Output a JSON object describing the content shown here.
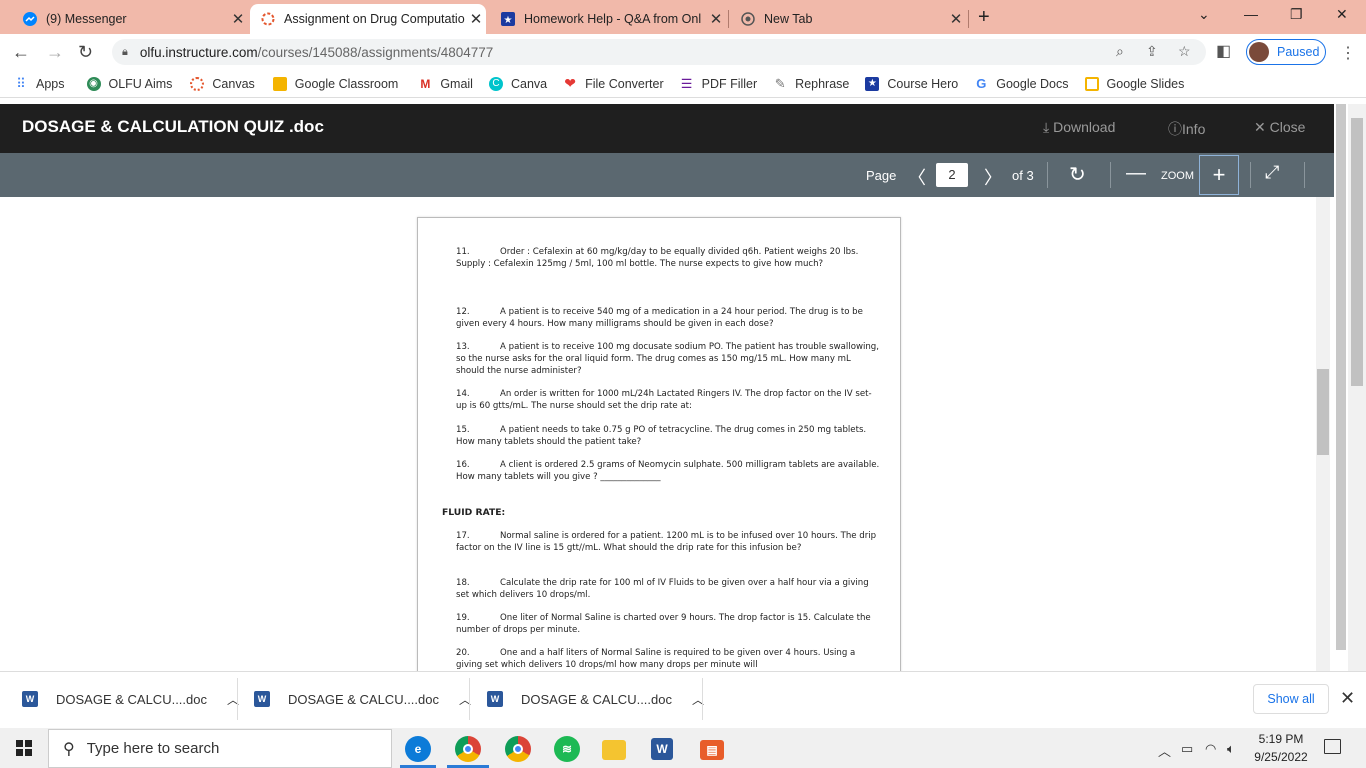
{
  "tabs": [
    {
      "title": "(9) Messenger",
      "icon": "messenger-icon",
      "color": "#0084ff"
    },
    {
      "title": "Assignment on Drug Computatio",
      "icon": "canvas-icon",
      "color": "#e4572e"
    },
    {
      "title": "Homework Help - Q&A from Onl",
      "icon": "course-hero-icon",
      "color": "#1b3aa0"
    },
    {
      "title": "New Tab",
      "icon": "chrome-icon",
      "color": "#555555"
    }
  ],
  "address": {
    "host": "olfu.instructure.com",
    "path": "/courses/145088/assignments/4804777",
    "profile_status": "Paused"
  },
  "bookmarks": [
    {
      "label": "Apps",
      "icon": "apps-grid-icon",
      "color": "#4285f4"
    },
    {
      "label": "OLFU Aims",
      "icon": "olfu-icon",
      "color": "#2e8b57"
    },
    {
      "label": "Canvas",
      "icon": "canvas-icon",
      "color": "#e4572e"
    },
    {
      "label": "Google Classroom",
      "icon": "classroom-icon",
      "color": "#f4b400"
    },
    {
      "label": "Gmail",
      "icon": "gmail-icon",
      "color": "#d93025"
    },
    {
      "label": "Canva",
      "icon": "canva-icon",
      "color": "#00c4cc"
    },
    {
      "label": "File Converter",
      "icon": "heart-icon",
      "color": "#e53935"
    },
    {
      "label": "PDF Filler",
      "icon": "pdf-filler-icon",
      "color": "#6a1b9a"
    },
    {
      "label": "Rephrase",
      "icon": "quill-icon",
      "color": "#777777"
    },
    {
      "label": "Course Hero",
      "icon": "course-hero-icon",
      "color": "#1b3aa0"
    },
    {
      "label": "Google Docs",
      "icon": "google-icon",
      "color": "#4285f4"
    },
    {
      "label": "Google Slides",
      "icon": "slides-icon",
      "color": "#f4b400"
    }
  ],
  "viewer": {
    "doc_title": "DOSAGE & CALCULATION QUIZ .doc",
    "download": "Download",
    "info": "Info",
    "close": "Close",
    "page_label": "Page",
    "page_current": "2",
    "page_total": "of 3",
    "zoom_label": "ZOOM"
  },
  "document": {
    "questions": [
      {
        "num": "11.",
        "text": "Order : Cefalexin at 60 mg/kg/day to be equally divided q6h. Patient weighs 20 lbs. Supply : Cefalexin 125mg / 5ml, 100 ml bottle. The nurse expects to give how much?"
      },
      {
        "num": "12.",
        "text": "A patient is to receive 540 mg of a medication in a 24 hour period.  The drug is to be given every 4 hours.  How many milligrams should be given in each dose?"
      },
      {
        "num": "13.",
        "text": "A patient is to receive  100 mg docusate sodium PO.  The patient has trouble swallowing, so the nurse asks for the oral liquid form.  The drug comes as 150 mg/15 mL.  How many mL should the nurse administer?"
      },
      {
        "num": "14.",
        "text": "An order is written for 1000 mL/24h  Lactated Ringers IV.  The drop factor on the IV set-up is 60 gtts/mL.  The nurse should set the drip rate at:"
      },
      {
        "num": "15.",
        "text": "A patient needs to take 0.75 g PO of tetracycline.  The drug comes in 250 mg tablets.  How many tablets should the patient take?"
      },
      {
        "num": "16.",
        "text": "A client is ordered 2.5 grams of Neomycin sulphate. 500 milligram tablets are available. How many tablets will you give ? ______________"
      }
    ],
    "section_heading": "FLUID RATE:",
    "fluid_questions": [
      {
        "num": "17.",
        "text": "Normal saline is ordered for a patient.  1200 mL is to be infused over 10 hours.  The drip factor on the IV line is 15 gtt//mL.  What should the drip rate for this infusion be?"
      },
      {
        "num": "18.",
        "text": "Calculate the drip rate for 100 ml of IV Fluids to be given over a half hour via a giving set which delivers 10 drops/ml."
      },
      {
        "num": "19.",
        "text": "One liter of Normal Saline is charted over 9 hours. The drop factor is 15. Calculate the number of drops per minute."
      },
      {
        "num": "20.",
        "text": "One and a half liters of Normal Saline is required to be given over 4 hours. Using a giving set which delivers 10 drops/ml how many drops per minute will"
      }
    ]
  },
  "downloads": {
    "items": [
      "DOSAGE & CALCU....doc",
      "DOSAGE & CALCU....doc",
      "DOSAGE & CALCU....doc"
    ],
    "show_all": "Show all"
  },
  "taskbar": {
    "search_placeholder": "Type here to search",
    "time": "5:19 PM",
    "date": "9/25/2022"
  }
}
